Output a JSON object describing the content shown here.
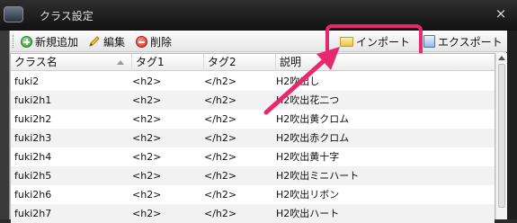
{
  "window": {
    "title": "クラス設定",
    "close_glyph": "×"
  },
  "toolbar": {
    "new_label": "新規追加",
    "edit_label": "編集",
    "delete_label": "削除",
    "import_label": "インポート",
    "export_label": "エクスポート"
  },
  "table": {
    "columns": [
      "クラス名",
      "タグ1",
      "タグ2",
      "説明"
    ],
    "rows": [
      {
        "name": "fuki2",
        "tag1": "<h2>",
        "tag2": "</h2>",
        "desc": "H2吹出し"
      },
      {
        "name": "fuki2h1",
        "tag1": "<h2>",
        "tag2": "</h2>",
        "desc": "H2吹出花二つ"
      },
      {
        "name": "fuki2h2",
        "tag1": "<h2>",
        "tag2": "</h2>",
        "desc": "H2吹出黄クロム"
      },
      {
        "name": "fuki2h3",
        "tag1": "<h2>",
        "tag2": "</h2>",
        "desc": "H2吹出赤クロム"
      },
      {
        "name": "fuki2h4",
        "tag1": "<h2>",
        "tag2": "</h2>",
        "desc": "H2吹出黄十字"
      },
      {
        "name": "fuki2h5",
        "tag1": "<h2>",
        "tag2": "</h2>",
        "desc": "H2吹出ミニハート"
      },
      {
        "name": "fuki2h6",
        "tag1": "<h2>",
        "tag2": "</h2>",
        "desc": "H2吹出リボン"
      },
      {
        "name": "fuki2h7",
        "tag1": "<h2>",
        "tag2": "</h2>",
        "desc": "H2吹出ハート"
      }
    ]
  },
  "annotation": {
    "highlight_color": "#e8286e"
  }
}
